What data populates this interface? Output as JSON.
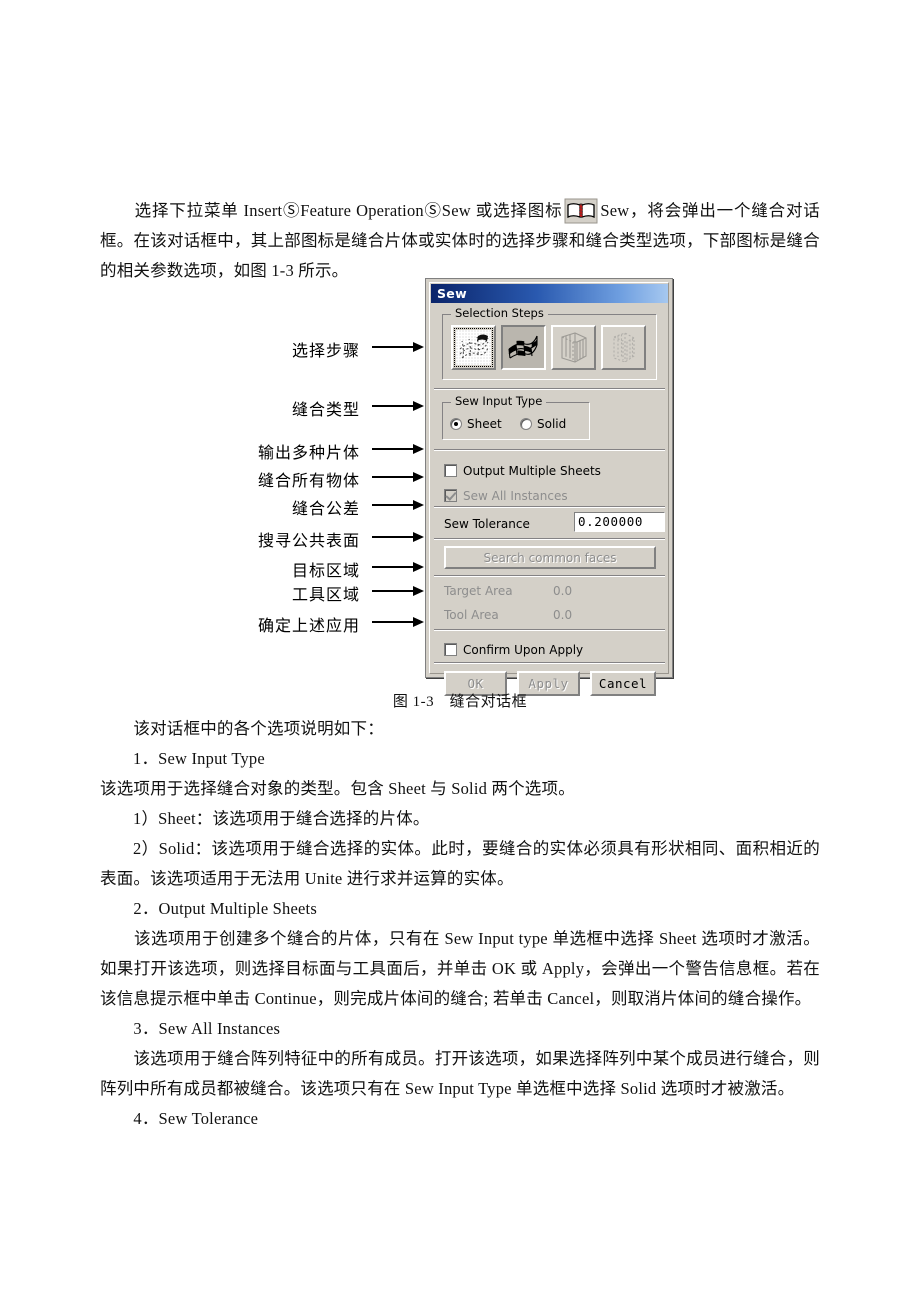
{
  "document": {
    "paragraphs": [
      {
        "id": "p1",
        "before_icon": "　　选择下拉菜单 InsertⓈFeature OperationⓈSew 或选择图标",
        "after_icon": "Sew，将会弹出一个缝合对话框。在该对话框中，其上部图标是缝合片体或实体时的选择步骤和缝合类型选项，下部图标是缝合的相关参数选项，如图 1-3 所示。",
        "icon_name": "sew-book-icon"
      },
      {
        "id": "p2",
        "text": "　　该对话框中的各个选项说明如下："
      },
      {
        "id": "p3",
        "text": "1．Sew Input Type"
      },
      {
        "id": "p4",
        "text": "该选项用于选择缝合对象的类型。包含 Sheet 与 Solid 两个选项。"
      },
      {
        "id": "p5",
        "text": "1）Sheet：该选项用于缝合选择的片体。"
      },
      {
        "id": "p6",
        "text": "2）Solid：该选项用于缝合选择的实体。此时，要缝合的实体必须具有形状相同、面积相近的表面。该选项适用于无法用 Unite 进行求并运算的实体。"
      },
      {
        "id": "p7",
        "text": "　　2．Output Multiple Sheets"
      },
      {
        "id": "p8",
        "text": "　　该选项用于创建多个缝合的片体，只有在 Sew Input type 单选框中选择 Sheet 选项时才激活。如果打开该选项，则选择目标面与工具面后，并单击 OK 或 Apply，会弹出一个警告信息框。若在该信息提示框中单击 Continue，则完成片体间的缝合; 若单击 Cancel，则取消片体间的缝合操作。"
      },
      {
        "id": "p9",
        "text": "　　3．Sew All Instances"
      },
      {
        "id": "p10",
        "text": "　　该选项用于缝合阵列特征中的所有成员。打开该选项，如果选择阵列中某个成员进行缝合，则阵列中所有成员都被缝合。该选项只有在 Sew Input Type 单选框中选择 Solid 选项时才被激活。"
      },
      {
        "id": "p11",
        "text": "　　4．Sew Tolerance"
      }
    ],
    "figure_caption": "图 1-3　缝合对话框"
  },
  "annotations": [
    {
      "label": "选择步骤",
      "target": "selection-steps"
    },
    {
      "label": "缝合类型",
      "target": "sew-input-type"
    },
    {
      "label": "输出多种片体",
      "target": "output-multiple-sheets"
    },
    {
      "label": "缝合所有物体",
      "target": "sew-all-instances"
    },
    {
      "label": "缝合公差",
      "target": "sew-tolerance"
    },
    {
      "label": "搜寻公共表面",
      "target": "search-common-faces"
    },
    {
      "label": "目标区域",
      "target": "target-area"
    },
    {
      "label": "工具区域",
      "target": "tool-area"
    },
    {
      "label": "确定上述应用",
      "target": "confirm-upon-apply"
    }
  ],
  "dialog": {
    "title": "Sew",
    "selection_steps": {
      "group_label": "Selection Steps",
      "buttons": [
        {
          "name": "step-target-sheet-icon",
          "state": "enabled",
          "pressed": false,
          "focus": true
        },
        {
          "name": "step-tool-sheet-icon",
          "state": "enabled",
          "pressed": true,
          "focus": false
        },
        {
          "name": "step-target-solid-icon",
          "state": "disabled",
          "pressed": false,
          "focus": false
        },
        {
          "name": "step-tool-solid-icon",
          "state": "disabled",
          "pressed": false,
          "focus": false
        }
      ]
    },
    "sew_input_type": {
      "group_label": "Sew Input Type",
      "options": [
        {
          "label": "Sheet",
          "selected": true
        },
        {
          "label": "Solid",
          "selected": false
        }
      ]
    },
    "output_multiple_sheets": {
      "label": "Output Multiple Sheets",
      "checked": false,
      "enabled": true
    },
    "sew_all_instances": {
      "label": "Sew All Instances",
      "checked": true,
      "enabled": false
    },
    "sew_tolerance": {
      "label": "Sew Tolerance",
      "value": "0.200000"
    },
    "search_common_faces": {
      "label": "Search common faces",
      "enabled": false
    },
    "target_area": {
      "label": "Target Area",
      "value": "0.0",
      "enabled": false
    },
    "tool_area": {
      "label": "Tool Area",
      "value": "0.0",
      "enabled": false
    },
    "confirm_upon_apply": {
      "label": "Confirm Upon Apply",
      "checked": false,
      "enabled": true
    },
    "action_buttons": [
      {
        "label": "OK",
        "enabled": false
      },
      {
        "label": "Apply",
        "enabled": false
      },
      {
        "label": "Cancel",
        "enabled": true
      }
    ]
  },
  "colors": {
    "dialog_face": "#d4d0c8",
    "titlebar_start": "#0a246a",
    "titlebar_end": "#a6c8f0",
    "disabled_text": "#8d8d8d",
    "field_bg": "#ffffff"
  }
}
